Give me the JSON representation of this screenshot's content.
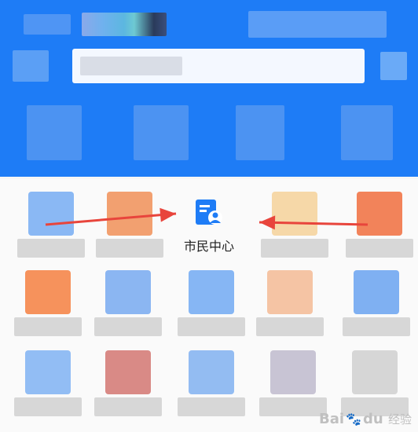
{
  "featured_app": {
    "label": "市民中心",
    "icon": "document-person-icon",
    "accent_color": "#1e7cf6"
  },
  "annotation": {
    "arrow_color": "#e8453c"
  },
  "watermark": {
    "brand_text": "Bai",
    "brand_suffix": "du",
    "sub_text": "经验"
  }
}
